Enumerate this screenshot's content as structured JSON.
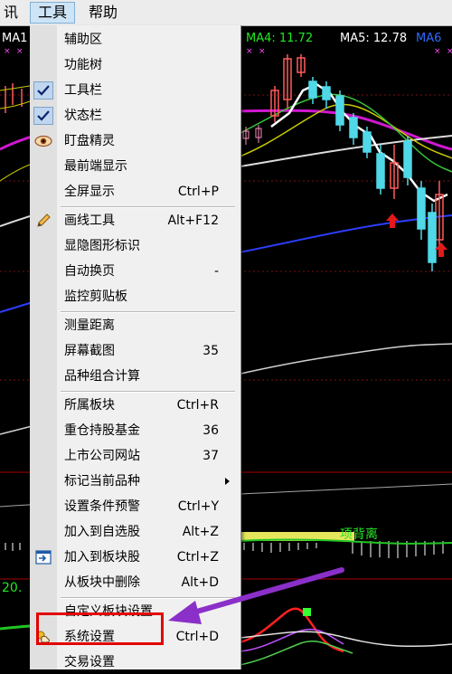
{
  "menubar": {
    "items": [
      {
        "label": "讯",
        "active": false
      },
      {
        "label": "工具",
        "active": true
      },
      {
        "label": "帮助",
        "active": false
      }
    ]
  },
  "chart": {
    "ma_left": "MA1",
    "ma4": "MA4: 11.72",
    "ma5": "MA5: 12.78",
    "ma6": "MA6",
    "lower_value": "20.",
    "annotation": "项背离"
  },
  "menu": {
    "items": [
      {
        "label": "辅助区",
        "shortcut": "",
        "icon": ""
      },
      {
        "label": "功能树",
        "shortcut": "",
        "icon": ""
      },
      {
        "label": "工具栏",
        "shortcut": "",
        "icon": "check-icon",
        "checked": true
      },
      {
        "label": "状态栏",
        "shortcut": "",
        "icon": "check-icon",
        "checked": true
      },
      {
        "label": "盯盘精灵",
        "shortcut": "",
        "icon": "eye-icon"
      },
      {
        "label": "最前端显示",
        "shortcut": "",
        "icon": ""
      },
      {
        "label": "全屏显示",
        "shortcut": "Ctrl+P",
        "icon": ""
      },
      {
        "separator": true
      },
      {
        "label": "画线工具",
        "shortcut": "Alt+F12",
        "icon": "pencil-icon"
      },
      {
        "label": "显隐图形标识",
        "shortcut": "",
        "icon": ""
      },
      {
        "label": "自动换页",
        "shortcut": "-",
        "icon": ""
      },
      {
        "label": "监控剪贴板",
        "shortcut": "",
        "icon": ""
      },
      {
        "separator": true
      },
      {
        "label": "测量距离",
        "shortcut": "",
        "icon": ""
      },
      {
        "label": "屏幕截图",
        "shortcut": "35",
        "icon": ""
      },
      {
        "label": "品种组合计算",
        "shortcut": "",
        "icon": ""
      },
      {
        "separator": true
      },
      {
        "label": "所属板块",
        "shortcut": "Ctrl+R",
        "icon": ""
      },
      {
        "label": "重仓持股基金",
        "shortcut": "36",
        "icon": ""
      },
      {
        "label": "上市公司网站",
        "shortcut": "37",
        "icon": ""
      },
      {
        "label": "标记当前品种",
        "shortcut": "",
        "icon": "",
        "submenu": true
      },
      {
        "label": "设置条件预警",
        "shortcut": "Ctrl+Y",
        "icon": ""
      },
      {
        "label": "加入到自选股",
        "shortcut": "Alt+Z",
        "icon": ""
      },
      {
        "label": "加入到板块股",
        "shortcut": "Ctrl+Z",
        "icon": "add-to-block-icon"
      },
      {
        "label": "从板块中删除",
        "shortcut": "Alt+D",
        "icon": ""
      },
      {
        "separator": true
      },
      {
        "label": "自定义板块设置",
        "shortcut": "",
        "icon": ""
      },
      {
        "label": "系统设置",
        "shortcut": "Ctrl+D",
        "icon": "settings-hand-icon",
        "highlighted": true
      },
      {
        "label": "交易设置",
        "shortcut": "",
        "icon": ""
      }
    ]
  },
  "colors": {
    "highlight_box": "#e30000",
    "arrow": "#8b2fc9",
    "candle_up": "#ff5a5a",
    "candle_down": "#4fd8e8"
  }
}
